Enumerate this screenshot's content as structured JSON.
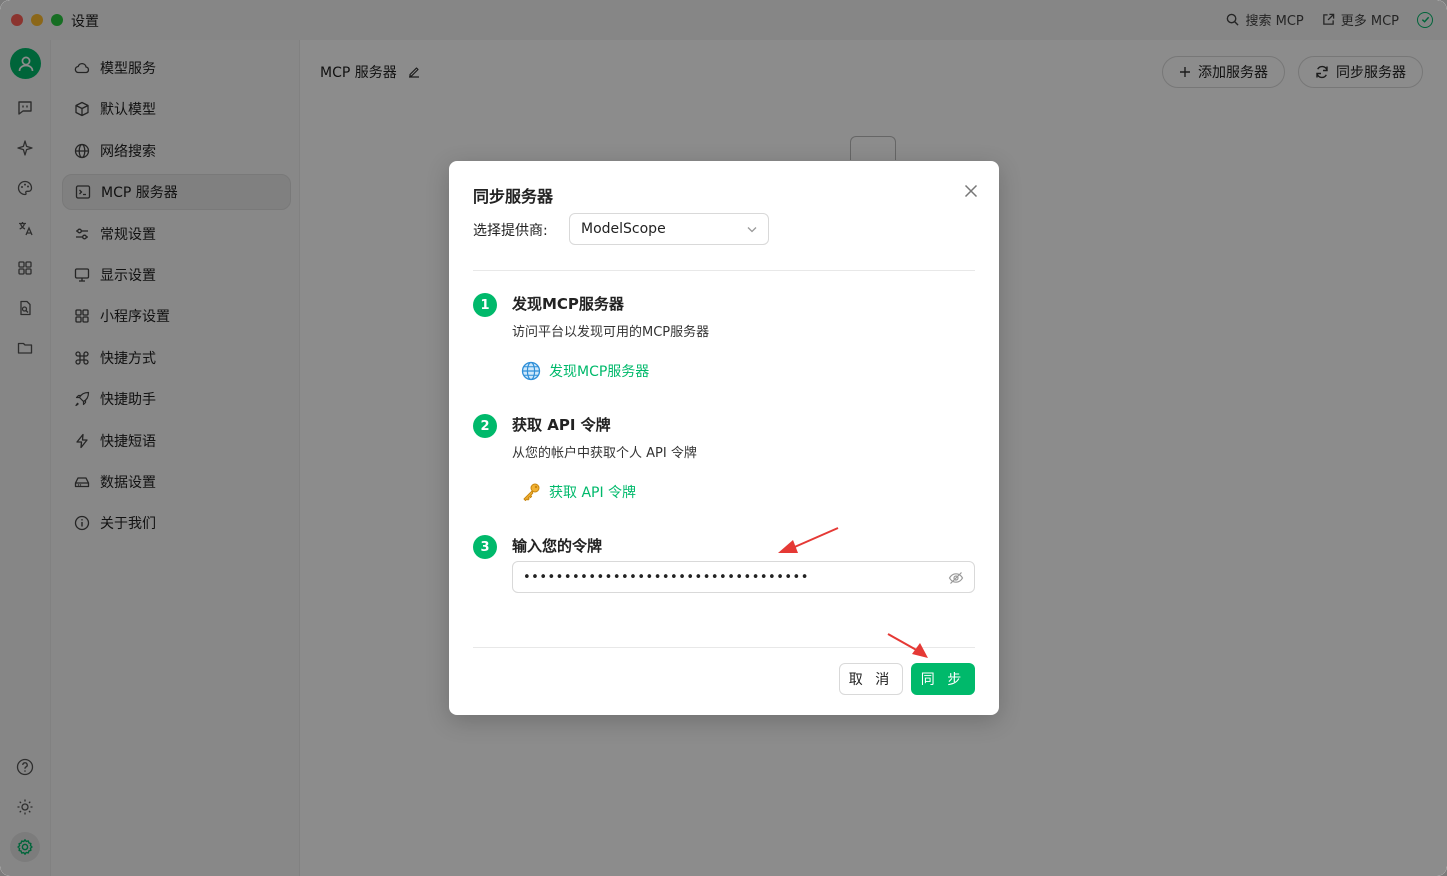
{
  "window": {
    "title": "设置"
  },
  "top_bar": {
    "search_mcp": "搜索 MCP",
    "more_mcp": "更多 MCP"
  },
  "sidebar": {
    "items": [
      {
        "label": "模型服务",
        "icon": "cloud-icon"
      },
      {
        "label": "默认模型",
        "icon": "cube-icon"
      },
      {
        "label": "网络搜索",
        "icon": "globe-icon"
      },
      {
        "label": "MCP 服务器",
        "icon": "terminal-icon",
        "active": true
      },
      {
        "label": "常规设置",
        "icon": "sliders-icon"
      },
      {
        "label": "显示设置",
        "icon": "monitor-icon"
      },
      {
        "label": "小程序设置",
        "icon": "grid-icon"
      },
      {
        "label": "快捷方式",
        "icon": "command-icon"
      },
      {
        "label": "快捷助手",
        "icon": "rocket-icon"
      },
      {
        "label": "快捷短语",
        "icon": "zap-icon"
      },
      {
        "label": "数据设置",
        "icon": "hard-drive-icon"
      },
      {
        "label": "关于我们",
        "icon": "info-icon"
      }
    ]
  },
  "main": {
    "title": "MCP 服务器",
    "add_server": "添加服务器",
    "sync_server": "同步服务器"
  },
  "modal": {
    "title": "同步服务器",
    "provider_label": "选择提供商:",
    "provider_value": "ModelScope",
    "steps": [
      {
        "num": "1",
        "title": "发现MCP服务器",
        "desc": "访问平台以发现可用的MCP服务器",
        "link": "发现MCP服务器",
        "link_icon": "globe-emoji-icon"
      },
      {
        "num": "2",
        "title": "获取 API 令牌",
        "desc": "从您的帐户中获取个人 API 令牌",
        "link": "获取 API 令牌",
        "link_icon": "key-emoji-icon"
      },
      {
        "num": "3",
        "title": "输入您的令牌"
      }
    ],
    "token_value": "•••••••••••••••••••••••••••••••••••",
    "cancel": "取 消",
    "sync": "同 步"
  },
  "colors": {
    "accent": "#00b96b",
    "annotation": "#e53935"
  }
}
